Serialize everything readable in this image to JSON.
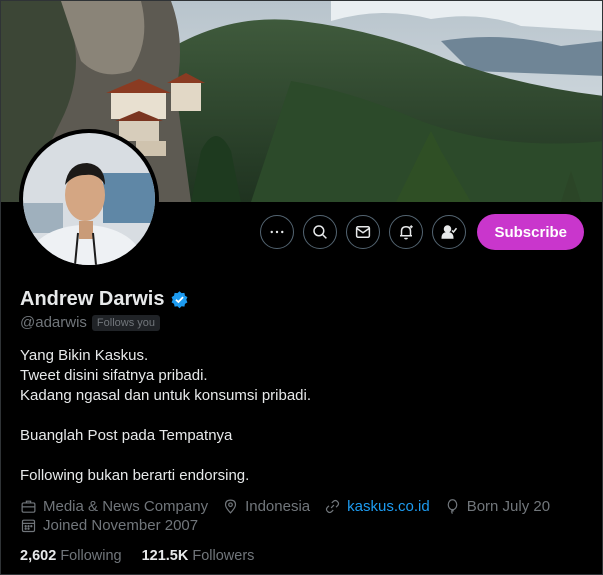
{
  "profile": {
    "name": "Andrew Darwis",
    "handle": "@adarwis",
    "follows_you": "Follows you",
    "verified_color": "#1d9bf0"
  },
  "actions": {
    "more_icon": "more-icon",
    "search_icon": "search-icon",
    "message_icon": "message-icon",
    "notify_icon": "notification-bell-icon",
    "following_icon": "following-user-icon",
    "subscribe_label": "Subscribe",
    "subscribe_color": "#c936cc"
  },
  "bio": {
    "line1": "Yang Bikin Kaskus.",
    "line2": "Tweet disini sifatnya pribadi.",
    "line3": "Kadang ngasal dan untuk konsumsi pribadi.",
    "line4": "Buanglah Post pada Tempatnya",
    "line5": "Following bukan berarti endorsing."
  },
  "meta": {
    "category": "Media & News Company",
    "location": "Indonesia",
    "website": "kaskus.co.id",
    "birthday": "Born July 20",
    "joined": "Joined November 2007"
  },
  "stats": {
    "following_count": "2,602",
    "following_label": "Following",
    "followers_count": "121.5K",
    "followers_label": "Followers"
  }
}
